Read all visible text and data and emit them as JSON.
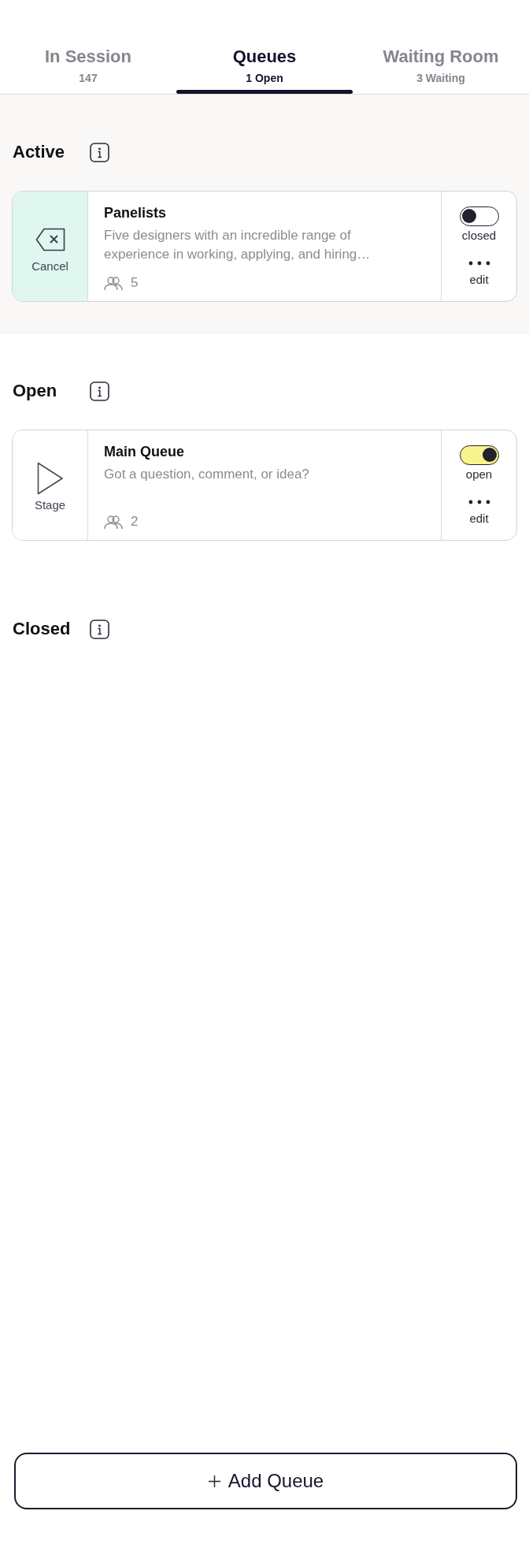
{
  "tabs": [
    {
      "label": "In Session",
      "count": "147",
      "selected": false
    },
    {
      "label": "Queues",
      "count": "1 Open",
      "selected": true
    },
    {
      "label": "Waiting Room",
      "count": "3 Waiting",
      "selected": false
    }
  ],
  "sections": [
    {
      "kind": "active",
      "title": "Active",
      "queues": [
        {
          "action": {
            "kind": "cancel",
            "label": "Cancel"
          },
          "name": "Panelists",
          "description": "Five designers with an incredible range of experience in working, applying, and hiring…",
          "members": "5",
          "open": false,
          "status": "closed",
          "edit_label": "edit"
        }
      ]
    },
    {
      "kind": "open",
      "title": "Open",
      "queues": [
        {
          "action": {
            "kind": "stage",
            "label": "Stage"
          },
          "name": "Main Queue",
          "description": "Got a question, comment, or idea?",
          "members": "2",
          "open": true,
          "status": "open",
          "edit_label": "edit"
        }
      ]
    },
    {
      "kind": "closed",
      "title": "Closed"
    }
  ],
  "add_button": {
    "label": "Add Queue"
  }
}
